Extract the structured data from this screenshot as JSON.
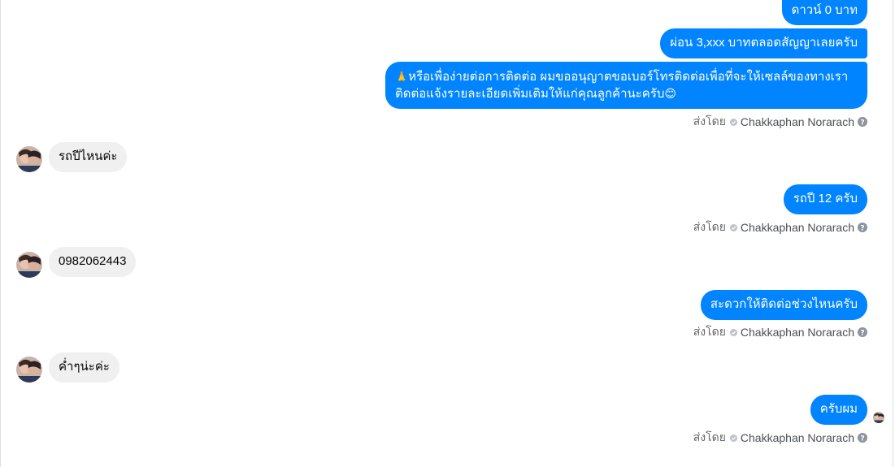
{
  "messages": {
    "m1": "ดาวน์ 0 บาท",
    "m2": "ผ่อน 3,xxx บาทตลอดสัญญาเลยครับ",
    "m3_line1": "หรือเพื่อง่ายต่อการติดต่อ ผมขออนุญาตขอเบอร์โทรติดต่อเพื่อที่จะให้เซลล์ของทางเรา",
    "m3_line2": "ติดต่อแจ้งรายละเอียดเพิ่มเติมให้แก่คุณลูกค้านะครับ",
    "m3_emoji_start": "🙏",
    "m3_emoji_end": "😊",
    "in1": "รถปีไหนค่ะ",
    "out2": "รถปี 12 ครับ",
    "in2": "0982062443",
    "out3": "สะดวกให้ติดต่อช่วงไหนครับ",
    "in3": "ค่ำๆน่ะค่ะ",
    "out4": "ครับผม"
  },
  "sent_by": {
    "prefix": "ส่งโดย",
    "agent": "Chakkaphan Norarach"
  },
  "colors": {
    "outgoing_bubble": "#0084ff",
    "incoming_bubble": "#f0f0f0",
    "meta_text": "#65676b"
  }
}
